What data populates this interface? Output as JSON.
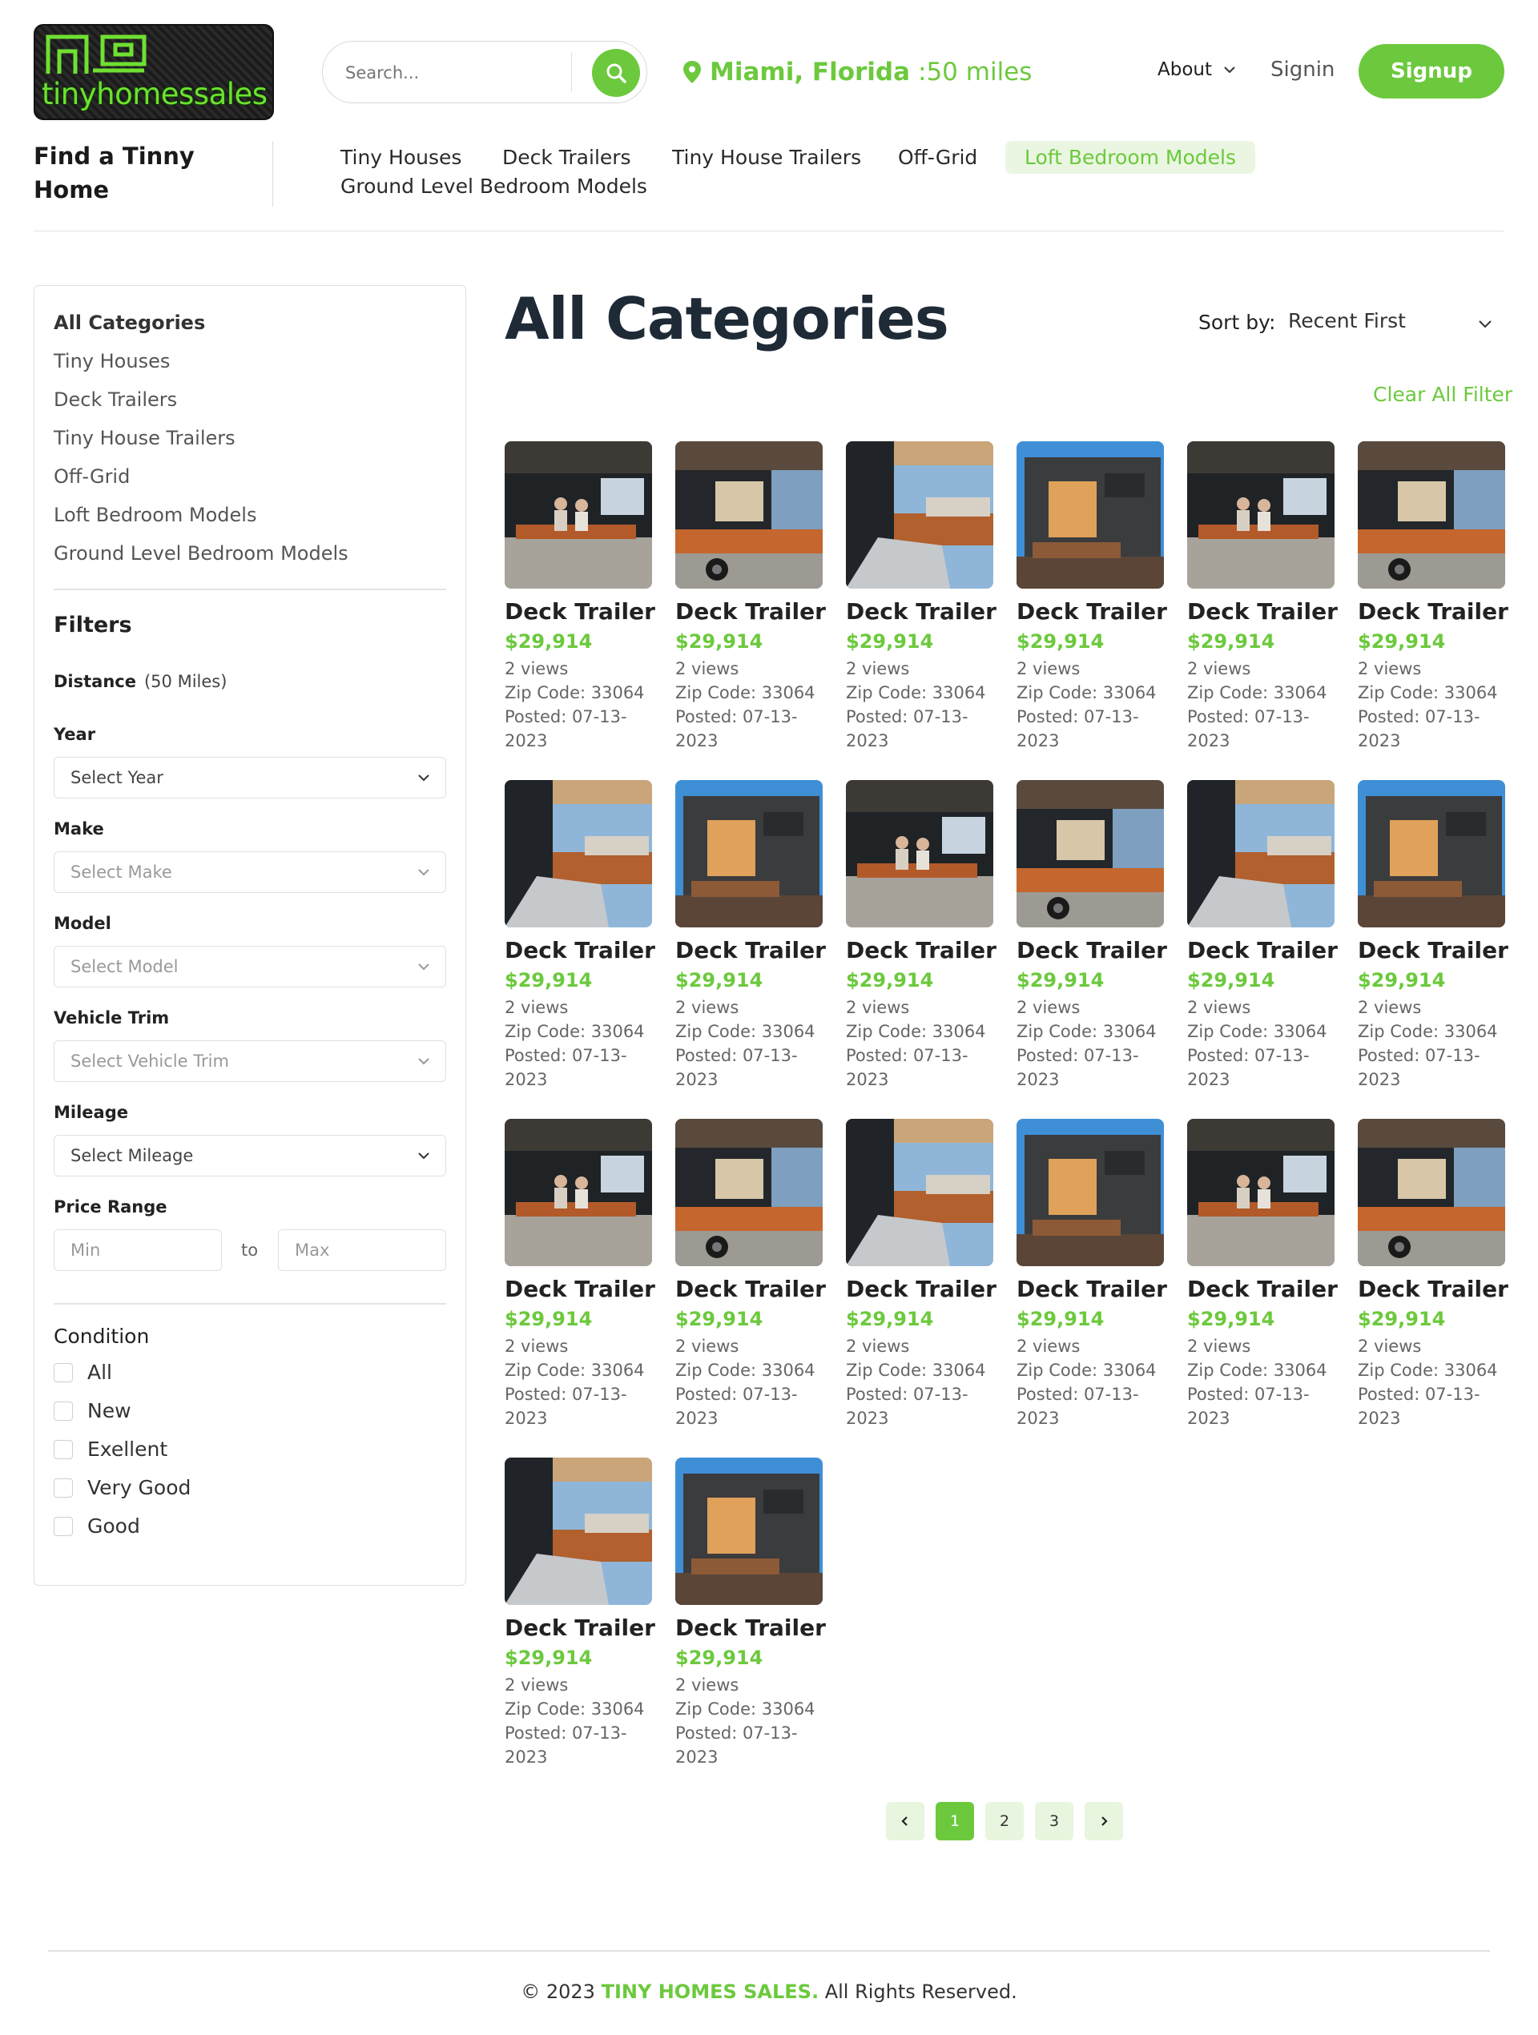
{
  "brand": {
    "logo_text": "tinyhomessales"
  },
  "search": {
    "placeholder": "Search..."
  },
  "location": {
    "city": "Miami, Florida",
    "radius": ":50 miles"
  },
  "header_nav": {
    "about": "About",
    "signin": "Signin",
    "signup": "Signup"
  },
  "section": {
    "find_title": "Find a Tinny Home"
  },
  "top_nav": [
    {
      "label": "Tiny Houses"
    },
    {
      "label": "Deck Trailers"
    },
    {
      "label": "Tiny House Trailers"
    },
    {
      "label": "Off-Grid"
    },
    {
      "label": "Loft Bedroom Models",
      "active": true
    },
    {
      "label": "Ground Level Bedroom Models"
    }
  ],
  "sidebar": {
    "categories": [
      {
        "label": "All Categories",
        "active": true
      },
      {
        "label": "Tiny Houses"
      },
      {
        "label": "Deck Trailers"
      },
      {
        "label": "Tiny House Trailers"
      },
      {
        "label": "Off-Grid"
      },
      {
        "label": "Loft Bedroom Models"
      },
      {
        "label": "Ground Level Bedroom Models"
      }
    ],
    "filters_title": "Filters",
    "distance_label": "Distance",
    "distance_value": "(50 Miles)",
    "year_label": "Year",
    "year_value": "Select Year",
    "make_label": "Make",
    "make_value": "Select Make",
    "model_label": "Model",
    "model_value": "Select Model",
    "trim_label": "Vehicle Trim",
    "trim_value": "Select Vehicle Trim",
    "mileage_label": "Mileage",
    "mileage_value": "Select Mileage",
    "price_label": "Price Range",
    "price_min_placeholder": "Min",
    "price_to": "to",
    "price_max_placeholder": "Max",
    "condition_title": "Condition",
    "conditions": [
      "All",
      "New",
      "Exellent",
      "Very Good",
      "Good"
    ]
  },
  "main": {
    "title": "All Categories",
    "sort_label": "Sort by:",
    "sort_value": "Recent First",
    "clear_filter": "Clear All Filter"
  },
  "listings": [
    {
      "title": "Deck Trailer",
      "price": "$29,914",
      "views": "2 views",
      "zip": "Zip Code: 33064",
      "posted_line1": "Posted: 07-13-",
      "posted_line2": "2023",
      "photo": "couple-deck"
    },
    {
      "title": "Deck Trailer",
      "price": "$29,914",
      "views": "2 views",
      "zip": "Zip Code: 33064",
      "posted_line1": "Posted: 07-13-",
      "posted_line2": "2023",
      "photo": "deck-wheel"
    },
    {
      "title": "Deck Trailer",
      "price": "$29,914",
      "views": "2 views",
      "zip": "Zip Code: 33064",
      "posted_line1": "Posted: 07-13-",
      "posted_line2": "2023",
      "photo": "sofa-porch"
    },
    {
      "title": "Deck Trailer",
      "price": "$29,914",
      "views": "2 views",
      "zip": "Zip Code: 33064",
      "posted_line1": "Posted: 07-13-",
      "posted_line2": "2023",
      "photo": "front-sky"
    },
    {
      "title": "Deck Trailer",
      "price": "$29,914",
      "views": "2 views",
      "zip": "Zip Code: 33064",
      "posted_line1": "Posted: 07-13-",
      "posted_line2": "2023",
      "photo": "couple-deck"
    },
    {
      "title": "Deck Trailer",
      "price": "$29,914",
      "views": "2 views",
      "zip": "Zip Code: 33064",
      "posted_line1": "Posted: 07-13-",
      "posted_line2": "2023",
      "photo": "deck-wheel"
    },
    {
      "title": "Deck Trailer",
      "price": "$29,914",
      "views": "2 views",
      "zip": "Zip Code: 33064",
      "posted_line1": "Posted: 07-13-",
      "posted_line2": "2023",
      "photo": "sofa-porch"
    },
    {
      "title": "Deck Trailer",
      "price": "$29,914",
      "views": "2 views",
      "zip": "Zip Code: 33064",
      "posted_line1": "Posted: 07-13-",
      "posted_line2": "2023",
      "photo": "front-sky"
    },
    {
      "title": "Deck Trailer",
      "price": "$29,914",
      "views": "2 views",
      "zip": "Zip Code: 33064",
      "posted_line1": "Posted: 07-13-",
      "posted_line2": "2023",
      "photo": "couple-deck"
    },
    {
      "title": "Deck Trailer",
      "price": "$29,914",
      "views": "2 views",
      "zip": "Zip Code: 33064",
      "posted_line1": "Posted: 07-13-",
      "posted_line2": "2023",
      "photo": "deck-wheel"
    },
    {
      "title": "Deck Trailer",
      "price": "$29,914",
      "views": "2 views",
      "zip": "Zip Code: 33064",
      "posted_line1": "Posted: 07-13-",
      "posted_line2": "2023",
      "photo": "sofa-porch"
    },
    {
      "title": "Deck Trailer",
      "price": "$29,914",
      "views": "2 views",
      "zip": "Zip Code: 33064",
      "posted_line1": "Posted: 07-13-",
      "posted_line2": "2023",
      "photo": "front-sky"
    },
    {
      "title": "Deck Trailer",
      "price": "$29,914",
      "views": "2 views",
      "zip": "Zip Code: 33064",
      "posted_line1": "Posted: 07-13-",
      "posted_line2": "2023",
      "photo": "couple-deck"
    },
    {
      "title": "Deck Trailer",
      "price": "$29,914",
      "views": "2 views",
      "zip": "Zip Code: 33064",
      "posted_line1": "Posted: 07-13-",
      "posted_line2": "2023",
      "photo": "deck-wheel"
    },
    {
      "title": "Deck Trailer",
      "price": "$29,914",
      "views": "2 views",
      "zip": "Zip Code: 33064",
      "posted_line1": "Posted: 07-13-",
      "posted_line2": "2023",
      "photo": "sofa-porch"
    },
    {
      "title": "Deck Trailer",
      "price": "$29,914",
      "views": "2 views",
      "zip": "Zip Code: 33064",
      "posted_line1": "Posted: 07-13-",
      "posted_line2": "2023",
      "photo": "front-sky"
    },
    {
      "title": "Deck Trailer",
      "price": "$29,914",
      "views": "2 views",
      "zip": "Zip Code: 33064",
      "posted_line1": "Posted: 07-13-",
      "posted_line2": "2023",
      "photo": "couple-deck"
    },
    {
      "title": "Deck Trailer",
      "price": "$29,914",
      "views": "2 views",
      "zip": "Zip Code: 33064",
      "posted_line1": "Posted: 07-13-",
      "posted_line2": "2023",
      "photo": "deck-wheel"
    },
    {
      "title": "Deck Trailer",
      "price": "$29,914",
      "views": "2 views",
      "zip": "Zip Code: 33064",
      "posted_line1": "Posted: 07-13-",
      "posted_line2": "2023",
      "photo": "sofa-porch"
    },
    {
      "title": "Deck Trailer",
      "price": "$29,914",
      "views": "2 views",
      "zip": "Zip Code: 33064",
      "posted_line1": "Posted: 07-13-",
      "posted_line2": "2023",
      "photo": "front-sky"
    }
  ],
  "pagination": {
    "pages": [
      "1",
      "2",
      "3"
    ],
    "current": "1",
    "prev_icon": "chevron-left-icon",
    "next_icon": "chevron-right-icon"
  },
  "footer": {
    "prefix": "© 2023 ",
    "brand": "TINY HOMES SALES.",
    "suffix": " All Rights Reserved."
  },
  "colors": {
    "accent": "#6cc93d",
    "accent_soft": "#eaf6e1",
    "heading": "#1f2a37"
  }
}
